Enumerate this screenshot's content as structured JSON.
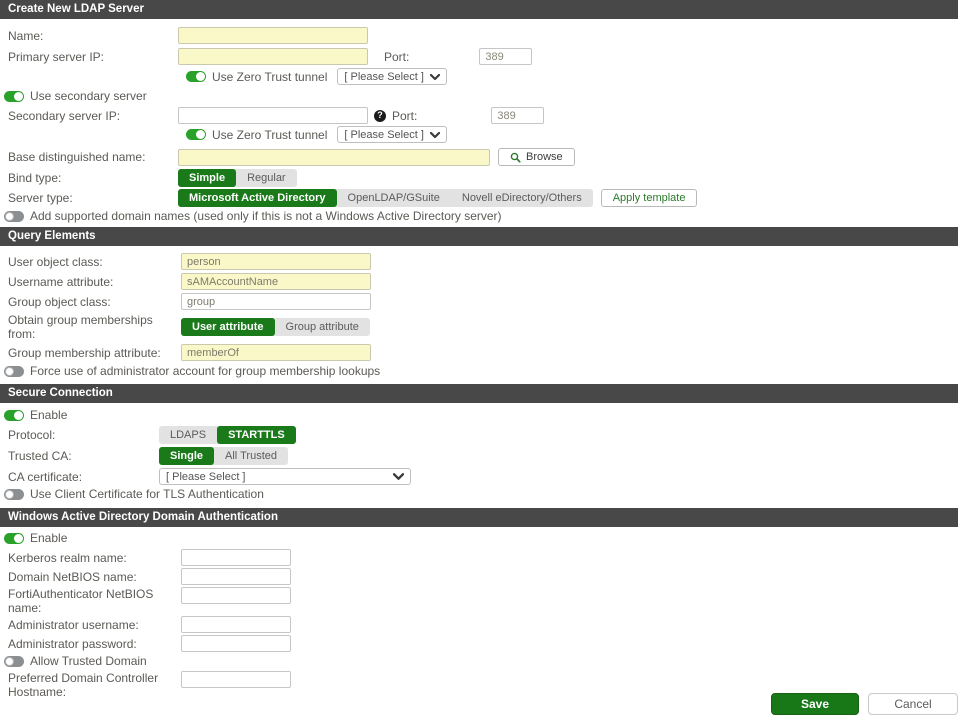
{
  "colors": {
    "header_bg": "#484848",
    "accent_green": "#1a7a1a",
    "toggle_on_green": "#2aa12a",
    "input_required_yellow": "#faf7c8",
    "save_green": "#187818"
  },
  "header": {
    "title": "Create New LDAP Server"
  },
  "basic": {
    "name_label": "Name:",
    "primary_ip_label": "Primary server IP:",
    "port_label": "Port:",
    "primary_port_value": "389",
    "zero_trust_label": "Use Zero Trust tunnel",
    "please_select": "[ Please Select ]",
    "use_secondary_label": "Use secondary server",
    "secondary_ip_label": "Secondary server IP:",
    "help_icon_glyph": "?",
    "secondary_port_value": "389",
    "base_dn_label": "Base distinguished name:",
    "browse_label": "Browse",
    "bind_type_label": "Bind type:",
    "bind_simple": "Simple",
    "bind_regular": "Regular",
    "server_type_label": "Server type:",
    "server_types": [
      "Microsoft Active Directory",
      "OpenLDAP/GSuite",
      "Novell eDirectory/Others"
    ],
    "apply_template_label": "Apply template",
    "add_domains_label": "Add supported domain names (used only if this is not a Windows Active Directory server)"
  },
  "query": {
    "title": "Query Elements",
    "user_object_class_label": "User object class:",
    "user_object_class_value": "person",
    "username_attr_label": "Username attribute:",
    "username_attr_value": "sAMAccountName",
    "group_object_class_label": "Group object class:",
    "group_object_class_value": "group",
    "obtain_label": "Obtain group memberships from:",
    "obtain_user_attr": "User attribute",
    "obtain_group_attr": "Group attribute",
    "group_membership_attr_label": "Group membership attribute:",
    "group_membership_attr_value": "memberOf",
    "force_admin_label": "Force use of administrator account for group membership lookups"
  },
  "secure": {
    "title": "Secure Connection",
    "enable_label": "Enable",
    "protocol_label": "Protocol:",
    "protocol_ldaps": "LDAPS",
    "protocol_starttls": "STARTTLS",
    "trusted_ca_label": "Trusted CA:",
    "trusted_single": "Single",
    "trusted_all": "All Trusted",
    "ca_cert_label": "CA certificate:",
    "ca_cert_value": "[ Please Select ]",
    "client_cert_label": "Use Client Certificate for TLS Authentication"
  },
  "winad": {
    "title": "Windows Active Directory Domain Authentication",
    "enable_label": "Enable",
    "kerberos_label": "Kerberos realm name:",
    "netbios_label": "Domain NetBIOS name:",
    "fac_netbios_label": "FortiAuthenticator NetBIOS name:",
    "admin_user_label": "Administrator username:",
    "admin_pass_label": "Administrator password:",
    "allow_trusted_label": "Allow Trusted Domain",
    "preferred_dc_label": "Preferred Domain Controller Hostname:"
  },
  "footer": {
    "save_label": "Save",
    "cancel_label": "Cancel"
  }
}
